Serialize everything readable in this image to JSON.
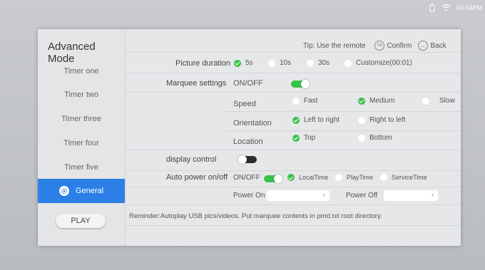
{
  "status": {
    "time": "04:44PM",
    "icons": [
      "battery-icon",
      "wifi-icon"
    ]
  },
  "sidebar": {
    "title": "Advanced Mode",
    "items": [
      {
        "label": "Timer one"
      },
      {
        "label": "Timer two"
      },
      {
        "label": "Timer three"
      },
      {
        "label": "Timer four"
      },
      {
        "label": "Timer five"
      },
      {
        "label": "General",
        "active": true
      }
    ],
    "play_label": "PLAY"
  },
  "tip": {
    "text": "Tip: Use the remote",
    "ok_icon_label": "OK",
    "confirm": "Confirm",
    "back": "Back"
  },
  "picture_duration": {
    "label": "Picture duration",
    "options": [
      "5s",
      "10s",
      "30s",
      "Customize(00:01)"
    ],
    "selected": "5s"
  },
  "marquee": {
    "label": "Marquee settings",
    "onoff": "ON/OFF",
    "enabled": true
  },
  "speed": {
    "label": "Speed",
    "options": [
      "Fast",
      "Medium",
      "Slow"
    ],
    "selected": "Medium"
  },
  "orientation": {
    "label": "Orientation",
    "options": [
      "Left to right",
      "Right to left"
    ],
    "selected": "Left to right"
  },
  "location": {
    "label": "Location",
    "options": [
      "Top",
      "Bottom"
    ],
    "selected": "Top"
  },
  "display_control": {
    "label": "display control",
    "enabled": false
  },
  "auto_power": {
    "label": "Auto power on/off",
    "onoff": "ON/OFF",
    "enabled": true,
    "options": [
      "LocalTime",
      "PlayTime",
      "ServiceTime"
    ],
    "selected": "LocalTime"
  },
  "power_times": {
    "on_label": "Power On",
    "off_label": "Power Off",
    "on_value": "",
    "off_value": ""
  },
  "reminder": "Reminder:Autoplay USB pics/videos.  Put marquee contents in pmd.txt root directory.",
  "colors": {
    "accent": "#2c7fe6",
    "check": "#38c24a",
    "panel": "#e6e7e9"
  }
}
